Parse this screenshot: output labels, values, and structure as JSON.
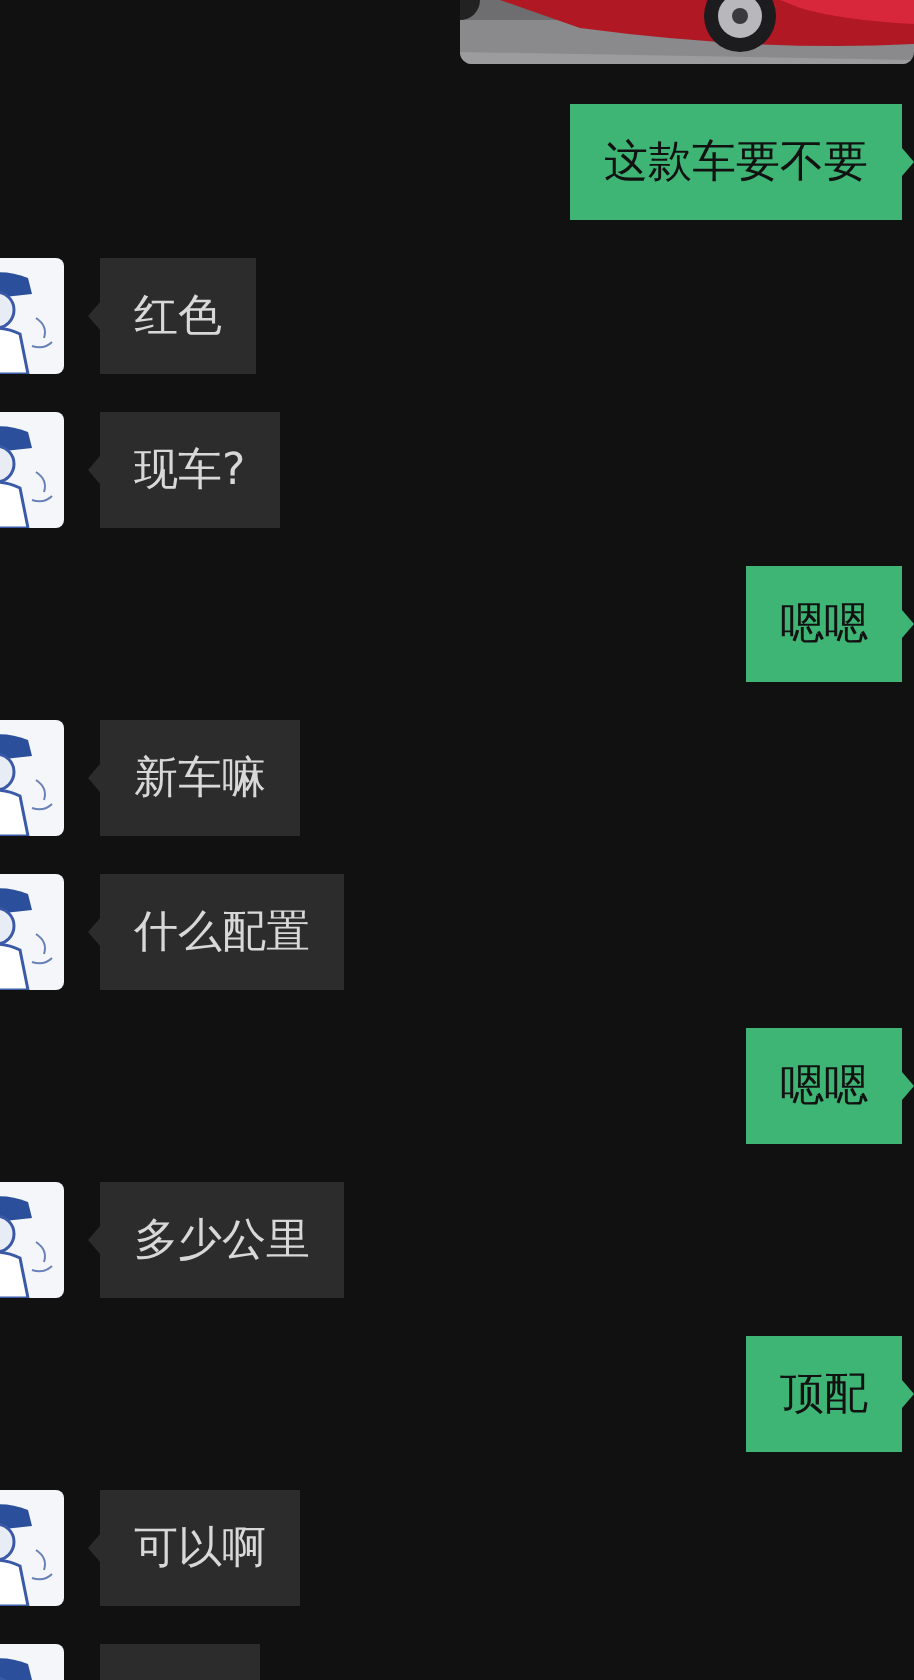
{
  "messages": [
    {
      "outgoing": true,
      "kind": "picture"
    },
    {
      "outgoing": true,
      "kind": "text",
      "text": "这款车要不要"
    },
    {
      "outgoing": false,
      "kind": "text",
      "text": "红色"
    },
    {
      "outgoing": false,
      "kind": "text",
      "text": "现车?"
    },
    {
      "outgoing": true,
      "kind": "text",
      "text": "嗯嗯"
    },
    {
      "outgoing": false,
      "kind": "text",
      "text": "新车嘛"
    },
    {
      "outgoing": false,
      "kind": "text",
      "text": "什么配置"
    },
    {
      "outgoing": true,
      "kind": "text",
      "text": "嗯嗯"
    },
    {
      "outgoing": false,
      "kind": "text",
      "text": "多少公里"
    },
    {
      "outgoing": true,
      "kind": "text",
      "text": "顶配"
    },
    {
      "outgoing": false,
      "kind": "text",
      "text": "可以啊"
    },
    {
      "outgoing": false,
      "kind": "empty"
    }
  ]
}
